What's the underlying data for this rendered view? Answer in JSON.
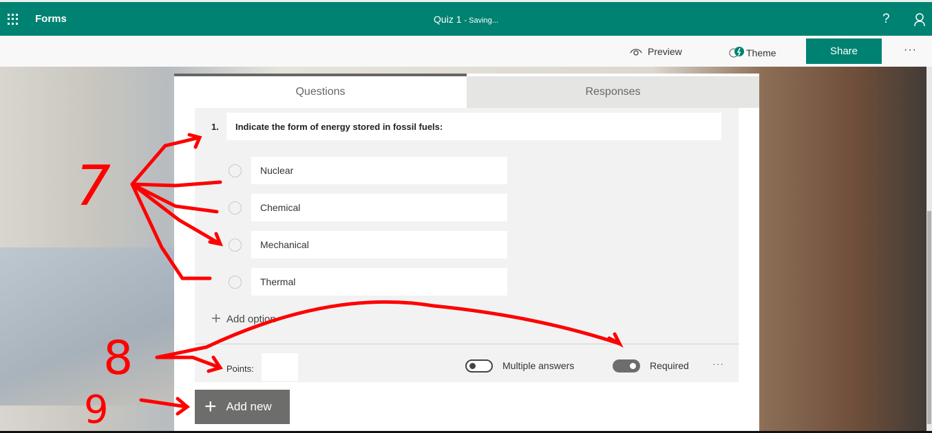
{
  "header": {
    "app_name": "Forms",
    "title": "Quiz 1",
    "status": "- Saving...",
    "help": "?"
  },
  "toolbar": {
    "preview": "Preview",
    "theme": "Theme",
    "share": "Share",
    "more": "···"
  },
  "tabs": [
    {
      "label": "Questions",
      "active": true
    },
    {
      "label": "Responses",
      "active": false
    }
  ],
  "question": {
    "number": "1.",
    "text": "Indicate the form of energy stored in fossil fuels:",
    "options": [
      "Nuclear",
      "Chemical",
      "Mechanical",
      "Thermal"
    ],
    "add_option": "Add option",
    "points_label": "Points:",
    "points_value": "",
    "multiple_answers": {
      "label": "Multiple answers",
      "on": false
    },
    "required": {
      "label": "Required",
      "on": true
    },
    "more": "···"
  },
  "add_new": "Add new",
  "annotations": {
    "color": "#ff0000",
    "labels": [
      "7",
      "8",
      "9"
    ]
  },
  "colors": {
    "brand": "#008272",
    "button_gray": "#6d6e6c"
  }
}
